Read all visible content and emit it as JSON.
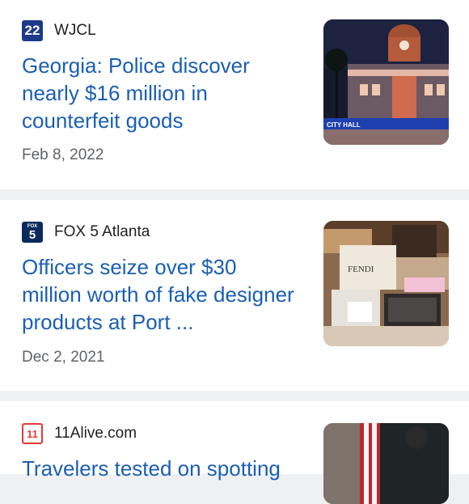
{
  "articles": [
    {
      "source": "WJCL",
      "source_logo_text": "22",
      "headline": "Georgia: Police discover nearly $16 million in counterfeit goods",
      "date": "Feb 8, 2022",
      "thumbnail_caption": "CITY HALL"
    },
    {
      "source": "FOX 5 Atlanta",
      "source_logo_text": "5",
      "headline": "Officers seize over $30 million worth of fake designer products at Port ...",
      "date": "Dec 2, 2021",
      "thumbnail_caption": "FENDI"
    },
    {
      "source": "11Alive.com",
      "source_logo_text": "11",
      "headline": "Travelers tested on spotting",
      "date": ""
    }
  ],
  "colors": {
    "link": "#1a5fb4",
    "wjcl_logo": "#1e3a8a",
    "fox_logo": "#0b2a5c",
    "alive_logo": "#e53935"
  }
}
